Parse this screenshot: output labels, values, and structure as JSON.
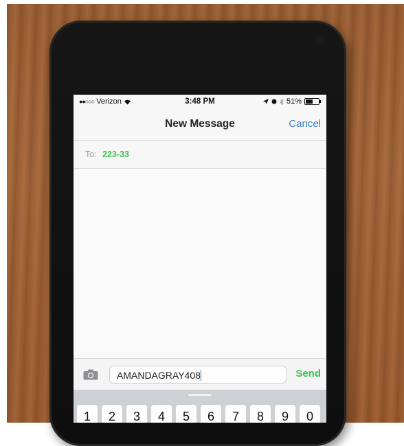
{
  "status_bar": {
    "carrier": "Verizon",
    "time": "3:48 PM",
    "battery": "51%",
    "battery_level": 0.51
  },
  "nav": {
    "title": "New Message",
    "cancel_label": "Cancel"
  },
  "recipient": {
    "label": "To:",
    "value": "223-33"
  },
  "compose": {
    "text": "AMANDAGRAY408",
    "send_label": "Send"
  },
  "keyboard": {
    "keys": [
      "1",
      "2",
      "3",
      "4",
      "5",
      "6",
      "7",
      "8",
      "9",
      "0"
    ]
  },
  "colors": {
    "accent_blue": "#2f7ed8",
    "accent_green": "#3cc155"
  }
}
